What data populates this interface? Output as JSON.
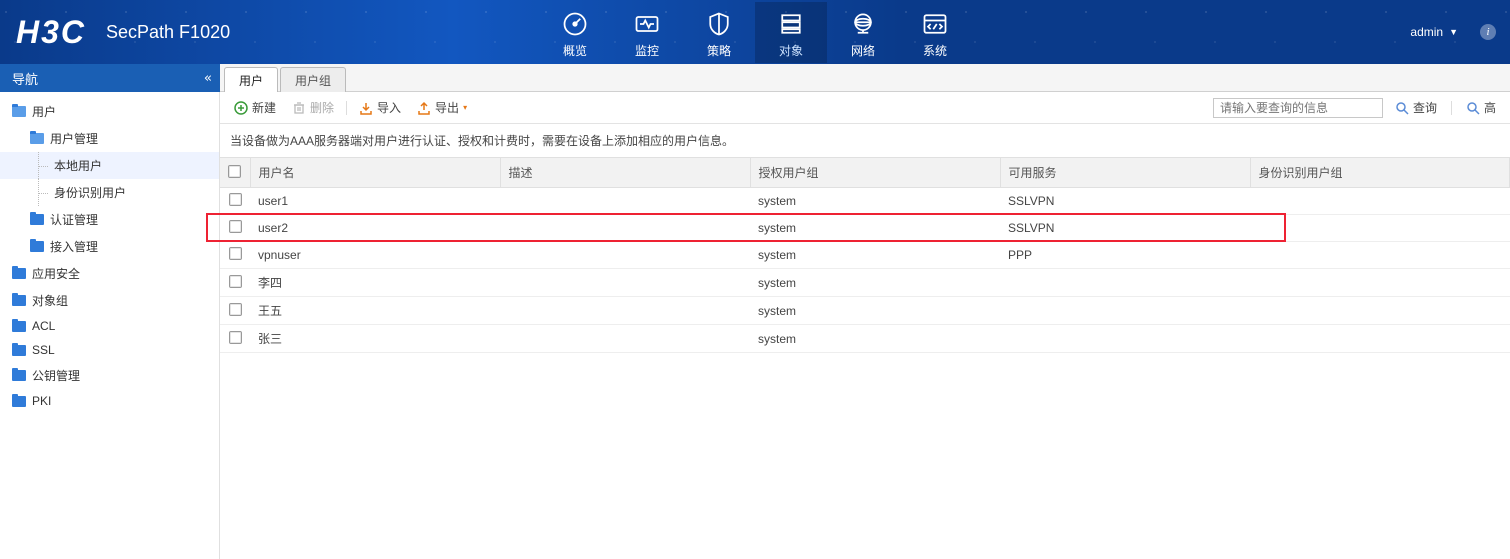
{
  "header": {
    "logo": "H3C",
    "product": "SecPath F1020",
    "admin": "admin"
  },
  "topnav": [
    {
      "label": "概览"
    },
    {
      "label": "监控"
    },
    {
      "label": "策略"
    },
    {
      "label": "对象"
    },
    {
      "label": "网络"
    },
    {
      "label": "系统"
    }
  ],
  "sidebar_title": "导航",
  "sidebar": [
    {
      "label": "用户",
      "lvl": 1,
      "open": true
    },
    {
      "label": "用户管理",
      "lvl": 2,
      "open": true
    },
    {
      "label": "本地用户",
      "lvl": 3,
      "selected": true
    },
    {
      "label": "身份识别用户",
      "lvl": 3
    },
    {
      "label": "认证管理",
      "lvl": 2
    },
    {
      "label": "接入管理",
      "lvl": 2
    },
    {
      "label": "应用安全",
      "lvl": 1
    },
    {
      "label": "对象组",
      "lvl": 1
    },
    {
      "label": "ACL",
      "lvl": 1
    },
    {
      "label": "SSL",
      "lvl": 1
    },
    {
      "label": "公钥管理",
      "lvl": 1
    },
    {
      "label": "PKI",
      "lvl": 1
    }
  ],
  "tabs": [
    {
      "label": "用户",
      "active": true
    },
    {
      "label": "用户组",
      "active": false
    }
  ],
  "toolbar": {
    "new": "新建",
    "delete": "删除",
    "import": "导入",
    "export": "导出",
    "search_placeholder": "请输入要查询的信息",
    "search_btn": "查询",
    "advanced": "高"
  },
  "hint": "当设备做为AAA服务器端对用户进行认证、授权和计费时，需要在设备上添加相应的用户信息。",
  "columns": [
    "用户名",
    "描述",
    "授权用户组",
    "可用服务",
    "身份识别用户组"
  ],
  "rows": [
    {
      "username": "user1",
      "desc": "",
      "group": "system",
      "service": "SSLVPN",
      "idgroup": ""
    },
    {
      "username": "user2",
      "desc": "",
      "group": "system",
      "service": "SSLVPN",
      "idgroup": "",
      "highlight": true
    },
    {
      "username": "vpnuser",
      "desc": "",
      "group": "system",
      "service": "PPP",
      "idgroup": ""
    },
    {
      "username": "李四",
      "desc": "",
      "group": "system",
      "service": "",
      "idgroup": ""
    },
    {
      "username": "王五",
      "desc": "",
      "group": "system",
      "service": "",
      "idgroup": ""
    },
    {
      "username": "张三",
      "desc": "",
      "group": "system",
      "service": "",
      "idgroup": ""
    }
  ]
}
